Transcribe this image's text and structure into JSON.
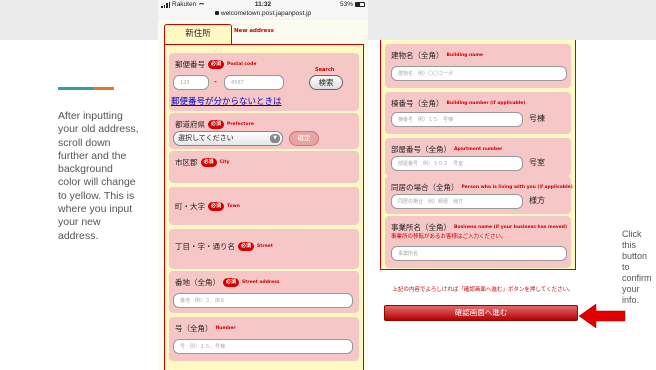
{
  "annotations": {
    "left_text": "After inputting\nyour old address,\nscroll down\nfurther and the\nbackground\ncolor will change\nto yellow. This is\nwhere you input\nyour new\naddress.",
    "right_text": "Click this\nbutton to\nconfirm\nyour info.",
    "accent_colors": [
      "#2aa3a3",
      "#e8762d"
    ]
  },
  "status_bar": {
    "carrier": "Rakuten",
    "time": "11:32",
    "battery": "53%",
    "url": "welcometown.post.japanpost.jp"
  },
  "tabs": {
    "active_label": "新住所",
    "active_en": "New address"
  },
  "required_badge": "必須",
  "form_left": {
    "postal": {
      "label": "郵便番号",
      "en": "Postal code",
      "placeholder1": "123",
      "placeholder2": "4567",
      "search_hint": "Search",
      "search_button": "検索",
      "lookup_link": "郵便番号が分からないときは"
    },
    "prefecture": {
      "label": "都道府県",
      "en": "Prefecture",
      "select_value": "選択してください",
      "confirm_button": "確定"
    },
    "city": {
      "label": "市区郡",
      "en": "City"
    },
    "town": {
      "label": "町・大字",
      "en": "Town"
    },
    "street": {
      "label": "丁目・字・通り名",
      "en": "Street"
    },
    "street_address": {
      "label": "番地（全角）",
      "en": "Street address",
      "placeholder": "番地　例）３、床６"
    },
    "number": {
      "label": "号（全角）",
      "en": "Number",
      "placeholder": "号　例）１５、号棟"
    }
  },
  "form_right": {
    "building_name": {
      "label": "建物名（全角）",
      "en": "Building name",
      "placeholder": "建物名　例）〇〇コーポ"
    },
    "building_number": {
      "label": "棟番号（全角）",
      "en": "Building number (if applicable)",
      "placeholder": "棟番号　例）１５　号棟",
      "suffix": "号棟"
    },
    "apartment": {
      "label": "部屋番号（全角）",
      "en": "Apartment number",
      "placeholder": "部屋番号　例）５０２　号室",
      "suffix": "号室"
    },
    "care_of": {
      "label": "同居の場合（全角）",
      "en": "Person who is living with you (if applicable)",
      "placeholder": "同居の場合　例）郵便　様方",
      "suffix": "様方"
    },
    "business_name": {
      "label": "事業所名（全角）",
      "en": "Business name (if your business has moved)",
      "note": "事業所の移転があるお客様はご入力ください。",
      "placeholder": "事業所名"
    }
  },
  "confirm": {
    "notice": "上記の内容でよろしければ「確認画面へ進む」ボタンを押してください。",
    "button": "確認画面へ進む"
  }
}
